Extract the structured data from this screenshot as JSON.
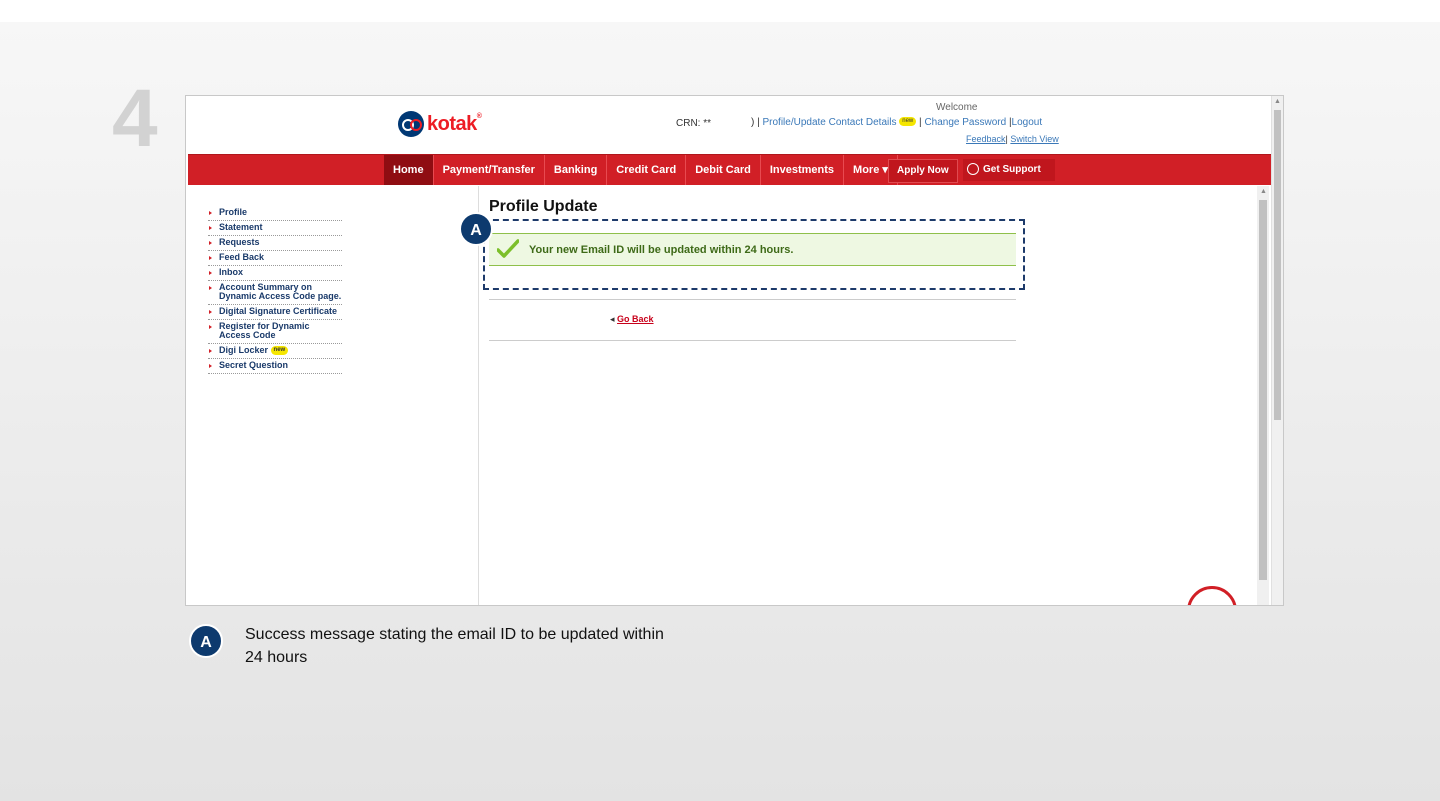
{
  "step_number": "4",
  "header": {
    "logo_text": "kotak",
    "logo_reg": "®",
    "welcome": "Welcome",
    "crn_label": "CRN:",
    "crn_value": "**",
    "links_prefix": ") |",
    "profile_link": "Profile/Update Contact Details",
    "new_badge": "new",
    "sep1": "|",
    "change_password": "Change Password",
    "sep2": "|",
    "logout": "Logout",
    "feedback": "Feedback",
    "sep3": "|",
    "switch_view": "Switch View"
  },
  "nav": {
    "items": [
      "Home",
      "Payment/Transfer",
      "Banking",
      "Credit Card",
      "Debit Card",
      "Investments",
      "More ▾"
    ],
    "apply_now": "Apply Now",
    "get_support": "Get Support"
  },
  "sidebar": {
    "items": [
      {
        "label": "Profile"
      },
      {
        "label": "Statement"
      },
      {
        "label": "Requests"
      },
      {
        "label": "Feed Back"
      },
      {
        "label": "Inbox"
      },
      {
        "label": "Account Summary on Dynamic Access Code page."
      },
      {
        "label": "Digital Signature Certificate"
      },
      {
        "label": "Register for Dynamic Access Code"
      },
      {
        "label": "Digi Locker",
        "badge": "new"
      },
      {
        "label": "Secret Question"
      }
    ]
  },
  "main": {
    "title": "Profile Update",
    "success_message": "Your new Email ID will be updated within 24 hours.",
    "go_back_arrow": "◂",
    "go_back": "Go Back"
  },
  "annotation": {
    "marker": "A",
    "caption": "Success message stating the email ID to be updated within 24 hours"
  },
  "colors": {
    "nav_red": "#d11f26",
    "callout_navy": "#0d3a6e",
    "success_green": "#3e6a18"
  }
}
